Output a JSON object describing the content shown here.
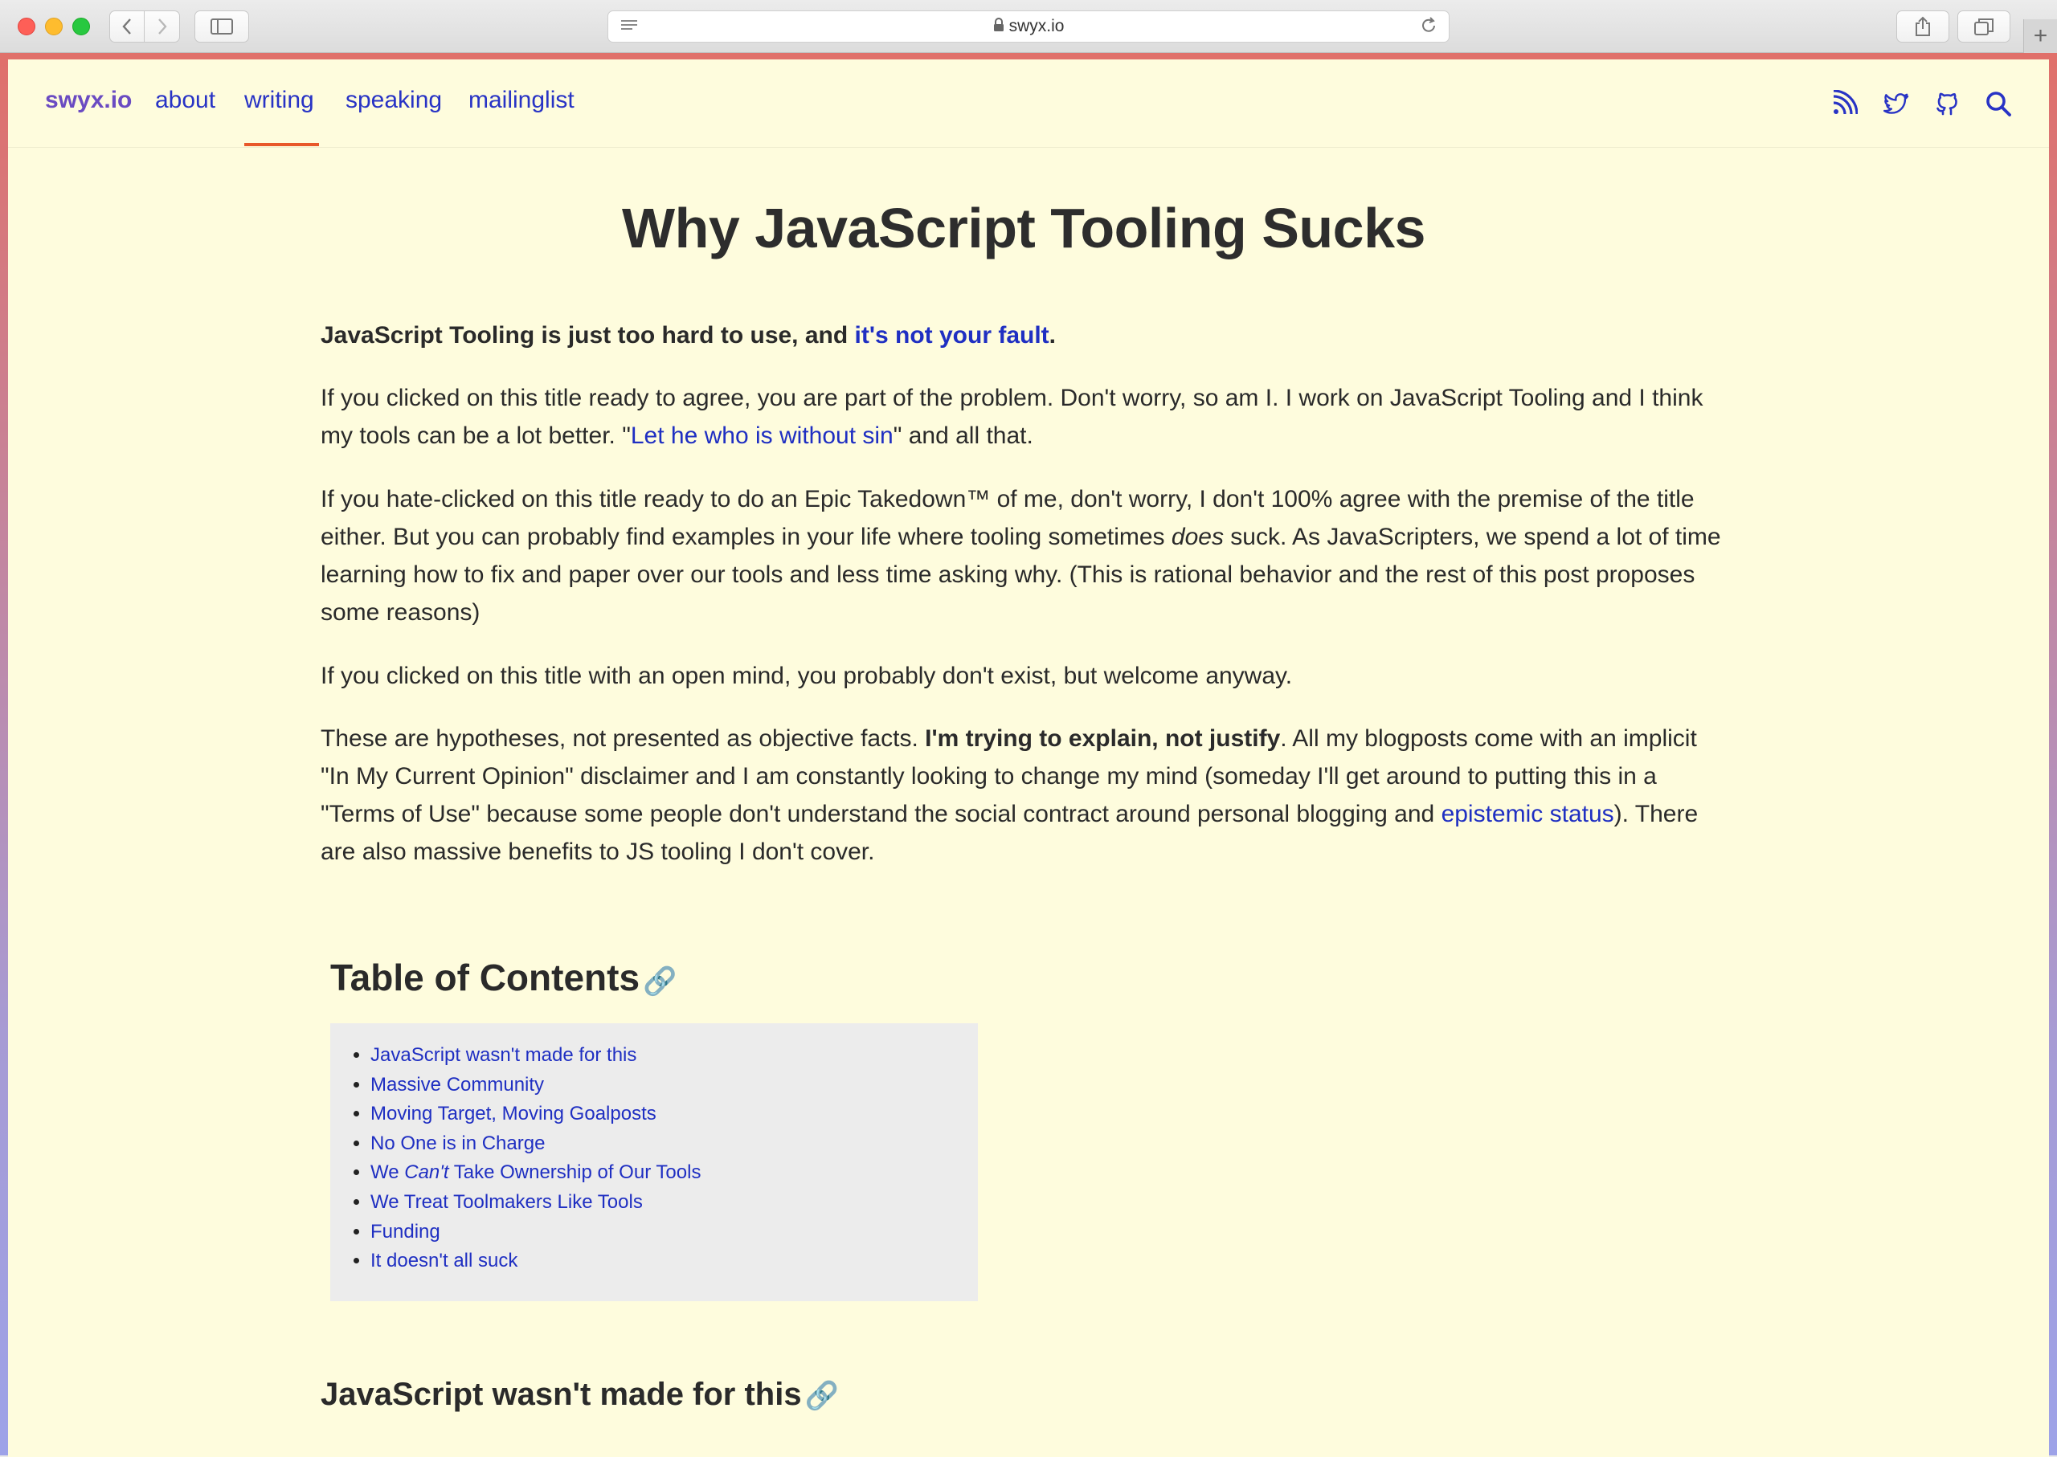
{
  "browser": {
    "url": "swyx.io",
    "new_tab_label": "+"
  },
  "nav": {
    "brand": "swyx.io",
    "links": [
      "about",
      "writing",
      "speaking",
      "mailinglist"
    ],
    "active": "writing",
    "icons": [
      "rss-icon",
      "twitter-icon",
      "github-icon",
      "search-icon"
    ]
  },
  "article": {
    "title": "Why JavaScript Tooling Sucks",
    "lead_text": "JavaScript Tooling is just too hard to use, and ",
    "lead_link": "it's not your fault",
    "lead_end": ".",
    "p1_a": "If you clicked on this title ready to agree, you are part of the problem. Don't worry, so am I. I work on JavaScript Tooling and I think my tools can be a lot better. \"",
    "p1_link": "Let he who is without sin",
    "p1_b": "\" and all that.",
    "p2_a": "If you hate-clicked on this title ready to do an Epic Takedown™ of me, don't worry, I don't 100% agree with the premise of the title either. But you can probably find examples in your life where tooling sometimes ",
    "p2_em": "does",
    "p2_b": " suck. As JavaScripters, we spend a lot of time learning how to fix and paper over our tools and less time asking why. (This is rational behavior and the rest of this post proposes some reasons)",
    "p3": "If you clicked on this title with an open mind, you probably don't exist, but welcome anyway.",
    "p4_a": "These are hypotheses, not presented as objective facts. ",
    "p4_strong": "I'm trying to explain, not justify",
    "p4_b": ". All my blogposts come with an implicit \"In My Current Opinion\" disclaimer and I am constantly looking to change my mind (someday I'll get around to putting this in a \"Terms of Use\" because some people don't understand the social contract around personal blogging and ",
    "p4_link": "epistemic status",
    "p4_c": "). There are also massive benefits to JS tooling I don't cover.",
    "toc_heading": "Table of Contents",
    "toc": [
      "JavaScript wasn't made for this",
      "Massive Community",
      "Moving Target, Moving Goalposts",
      "No One is in Charge",
      "Take Ownership of Our Tools",
      "We Treat Toolmakers Like Tools",
      "Funding",
      "It doesn't all suck"
    ],
    "toc_item5_prefix": "We ",
    "toc_item5_em": "Can't",
    "section_heading": "JavaScript wasn't made for this",
    "anchor_glyph": "🔗"
  }
}
